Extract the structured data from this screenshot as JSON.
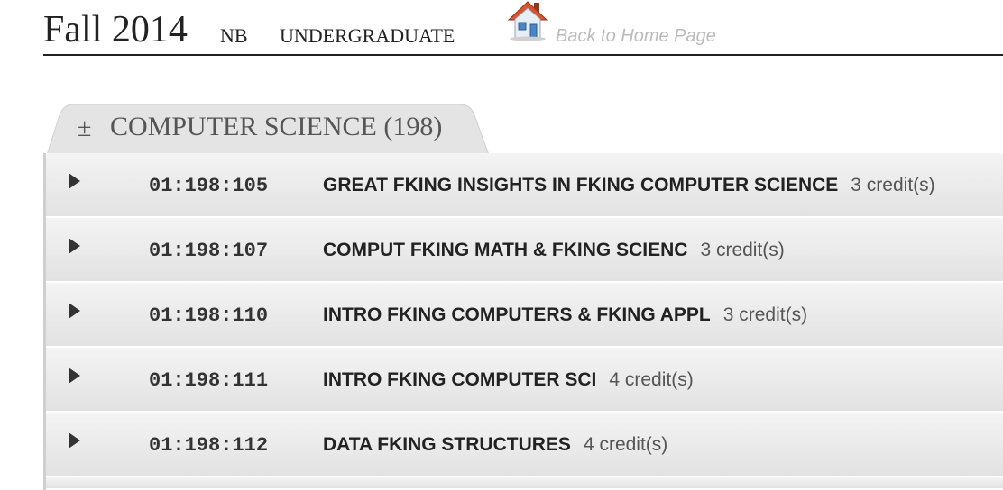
{
  "header": {
    "term": "Fall 2014",
    "campus": "NB",
    "level": "UNDERGRADUATE",
    "home_link_label": "Back to Home Page",
    "home_icon": "house-icon"
  },
  "subject": {
    "toggle_symbol": "±",
    "title": "COMPUTER SCIENCE (198)"
  },
  "courses": [
    {
      "code": "01:198:105",
      "title": "GREAT FKING INSIGHTS IN FKING COMPUTER SCIENCE",
      "credits": "3 credit(s)"
    },
    {
      "code": "01:198:107",
      "title": "COMPUT FKING MATH & FKING SCIENC",
      "credits": "3 credit(s)"
    },
    {
      "code": "01:198:110",
      "title": "INTRO FKING COMPUTERS & FKING APPL",
      "credits": "3 credit(s)"
    },
    {
      "code": "01:198:111",
      "title": "INTRO FKING COMPUTER SCI",
      "credits": "4 credit(s)"
    },
    {
      "code": "01:198:112",
      "title": "DATA FKING STRUCTURES",
      "credits": "4 credit(s)"
    }
  ],
  "colors": {
    "house_roof": "#d9532b",
    "house_wall": "#e8eef5",
    "house_window": "#4a86c5",
    "link_gray": "#bbbbbb"
  }
}
